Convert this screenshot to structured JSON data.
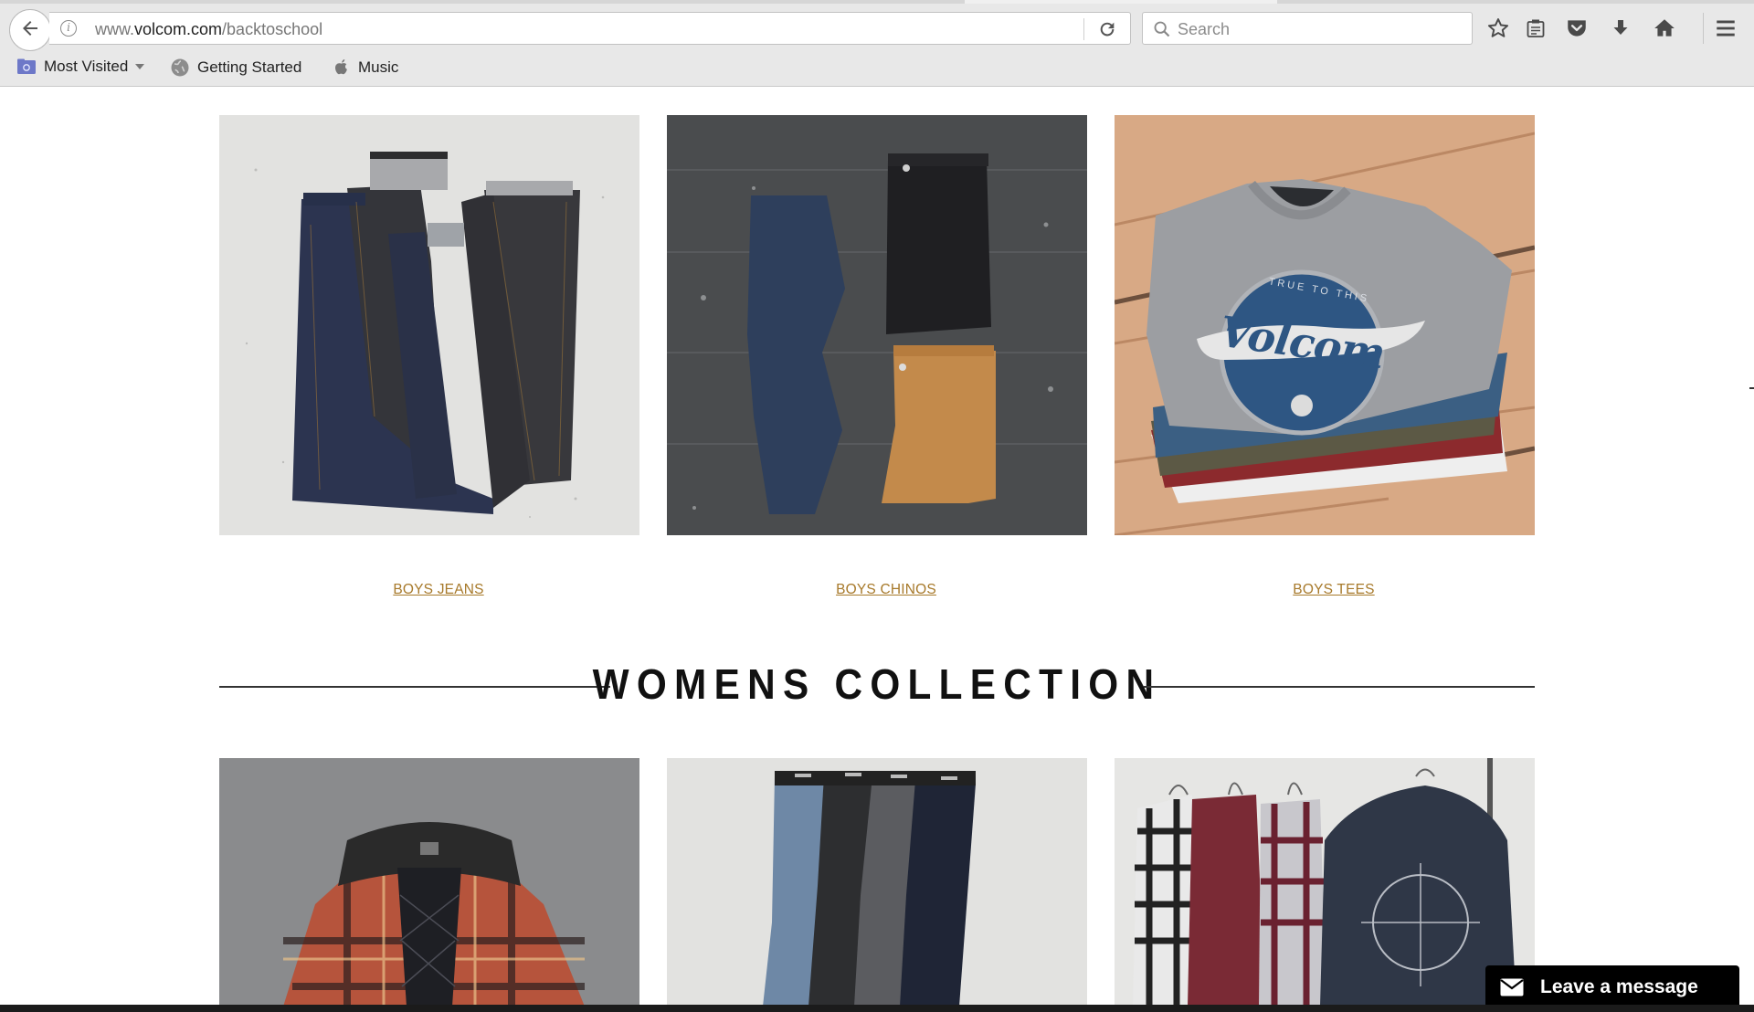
{
  "browser": {
    "url_prefix": "www.",
    "url_host": "volcom.com",
    "url_path": "/backtoschool",
    "search_placeholder": "Search",
    "bookmarks": [
      {
        "label": "Most Visited"
      },
      {
        "label": "Getting Started"
      },
      {
        "label": "Music"
      }
    ]
  },
  "boys": {
    "links": [
      {
        "label": "BOYS JEANS"
      },
      {
        "label": "BOYS CHINOS"
      },
      {
        "label": "BOYS TEES"
      }
    ]
  },
  "womens": {
    "title": "WOMENS COLLECTION"
  },
  "tee_graphic": {
    "top_text": "TRUE TO THIS",
    "brand": "Volcom"
  },
  "chat": {
    "label": "Leave a message"
  },
  "colors": {
    "link": "#a7792a",
    "chrome": "#e8e8e8",
    "heading": "#111111"
  }
}
